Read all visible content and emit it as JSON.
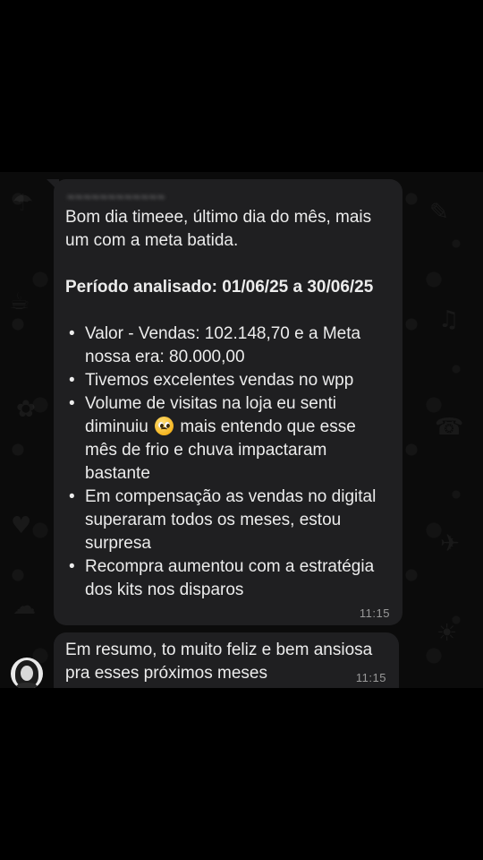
{
  "chat": {
    "messages": [
      {
        "sender": "~~~~~~~~~~~~",
        "intro_lines": [
          "Bom dia timeee, último dia do mês, mais",
          "um com a meta batida."
        ],
        "period": "Período analisado: 01/06/25 a 30/06/25",
        "bullets": [
          {
            "lines": [
              "Valor - Vendas: 102.148,70 e a Meta",
              "nossa era: 80.000,00"
            ]
          },
          {
            "lines": [
              "Tivemos excelentes vendas no wpp"
            ]
          },
          {
            "lines": [
              "Volume de visitas na loja eu senti",
              "diminuiu",
              "mais entendo que esse",
              "mês de frio e chuva impactaram",
              "bastante"
            ]
          },
          {
            "lines": [
              "Em compensação as vendas no digital",
              "superaram todos os meses, estou",
              "surpresa"
            ]
          },
          {
            "lines": [
              "Recompra aumentou com a estratégia",
              "dos kits nos disparos"
            ]
          }
        ],
        "time": "11:15"
      },
      {
        "lines": [
          "Em resumo, to muito feliz e bem ansiosa",
          "pra esses próximos meses"
        ],
        "time": "11:15"
      }
    ],
    "emoji": "pleading-face-emoji",
    "bubble_color": "#1f1f21",
    "text_color": "#ececec",
    "time_color": "#9a9a9a"
  }
}
